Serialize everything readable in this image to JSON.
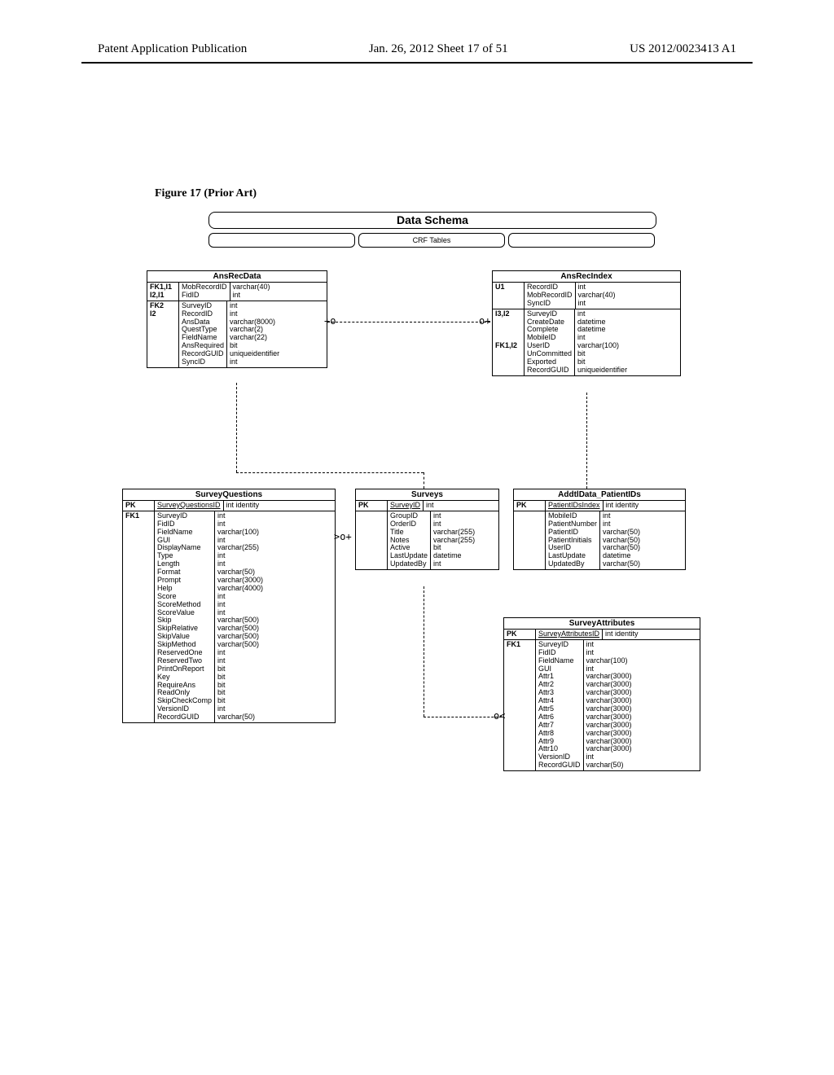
{
  "header": {
    "left": "Patent Application Publication",
    "center": "Jan. 26, 2012  Sheet 17 of 51",
    "right": "US 2012/0023413 A1"
  },
  "figure_caption": "Figure 17 (Prior Art)",
  "schema": {
    "title": "Data Schema",
    "subtitle_center": "CRF Tables",
    "tables": {
      "AnsRecData": {
        "sections": [
          {
            "key": "FK1,I1\nI2,I1",
            "rows": [
              [
                "MobRecordID",
                "varchar(40)"
              ],
              [
                "FidID",
                "int"
              ]
            ]
          },
          {
            "key": "FK2\nI2",
            "rows": [
              [
                "SurveyID",
                "int"
              ],
              [
                "RecordID",
                "int"
              ],
              [
                "AnsData",
                "varchar(8000)"
              ],
              [
                "QuestType",
                "varchar(2)"
              ],
              [
                "FieldName",
                "varchar(22)"
              ],
              [
                "AnsRequired",
                "bit"
              ],
              [
                "RecordGUID",
                "uniqueidentifier"
              ],
              [
                "SyncID",
                "int"
              ]
            ]
          }
        ]
      },
      "AnsRecIndex": {
        "sections": [
          {
            "key": "U1",
            "rows": [
              [
                "RecordID",
                "int"
              ],
              [
                "MobRecordID",
                "varchar(40)"
              ],
              [
                "SyncID",
                "int"
              ]
            ]
          },
          {
            "key": "I3,I2\n\n\n\nFK1,I2",
            "rows": [
              [
                "SurveyID",
                "int"
              ],
              [
                "CreateDate",
                "datetime"
              ],
              [
                "Complete",
                "datetime"
              ],
              [
                "MobileID",
                "int"
              ],
              [
                "UserID",
                "varchar(100)"
              ],
              [
                "UnCommitted",
                "bit"
              ],
              [
                "Exported",
                "bit"
              ],
              [
                "RecordGUID",
                "uniqueidentifier"
              ]
            ]
          }
        ]
      },
      "SurveyQuestions": {
        "sections": [
          {
            "key": "PK",
            "rows": [
              [
                "SurveyQuestionsID",
                "int identity"
              ]
            ],
            "underlineFirst": true
          },
          {
            "key": "FK1",
            "rows": [
              [
                "SurveyID",
                "int"
              ],
              [
                "FidID",
                "int"
              ],
              [
                "FieldName",
                "varchar(100)"
              ],
              [
                "GUI",
                "int"
              ],
              [
                "DisplayName",
                "varchar(255)"
              ],
              [
                "Type",
                "int"
              ],
              [
                "Length",
                "int"
              ],
              [
                "Format",
                "varchar(50)"
              ],
              [
                "Prompt",
                "varchar(3000)"
              ],
              [
                "Help",
                "varchar(4000)"
              ],
              [
                "Score",
                "int"
              ],
              [
                "ScoreMethod",
                "int"
              ],
              [
                "ScoreValue",
                "int"
              ],
              [
                "Skip",
                "varchar(500)"
              ],
              [
                "SkipRelative",
                "varchar(500)"
              ],
              [
                "SkipValue",
                "varchar(500)"
              ],
              [
                "SkipMethod",
                "varchar(500)"
              ],
              [
                "ReservedOne",
                "int"
              ],
              [
                "ReservedTwo",
                "int"
              ],
              [
                "PrintOnReport",
                "bit"
              ],
              [
                "Key",
                "bit"
              ],
              [
                "RequireAns",
                "bit"
              ],
              [
                "ReadOnly",
                "bit"
              ],
              [
                "SkipCheckComp",
                "bit"
              ],
              [
                "VersionID",
                "int"
              ],
              [
                "RecordGUID",
                "varchar(50)"
              ]
            ]
          }
        ]
      },
      "Surveys": {
        "sections": [
          {
            "key": "PK",
            "rows": [
              [
                "SurveyID",
                "int"
              ]
            ],
            "underlineFirst": true
          },
          {
            "key": "",
            "rows": [
              [
                "GroupID",
                "int"
              ],
              [
                "OrderID",
                "int"
              ],
              [
                "Title",
                "varchar(255)"
              ],
              [
                "Notes",
                "varchar(255)"
              ],
              [
                "Active",
                "bit"
              ],
              [
                "LastUpdate",
                "datetime"
              ],
              [
                "UpdatedBy",
                "int"
              ]
            ]
          }
        ]
      },
      "AddtlData_PatientIDs": {
        "sections": [
          {
            "key": "PK",
            "rows": [
              [
                "PatientIDsIndex",
                "int identity"
              ]
            ],
            "underlineFirst": true
          },
          {
            "key": "",
            "rows": [
              [
                "MobileID",
                "int"
              ],
              [
                "PatientNumber",
                "int"
              ],
              [
                "PatientID",
                "varchar(50)"
              ],
              [
                "PatientInitials",
                "varchar(50)"
              ],
              [
                "UserID",
                "varchar(50)"
              ],
              [
                "LastUpdate",
                "datetime"
              ],
              [
                "UpdatedBy",
                "varchar(50)"
              ]
            ]
          }
        ]
      },
      "SurveyAttributes": {
        "sections": [
          {
            "key": "PK",
            "rows": [
              [
                "SurveyAttributesID",
                "int identity"
              ]
            ],
            "underlineFirst": true
          },
          {
            "key": "FK1",
            "rows": [
              [
                "SurveyID",
                "int"
              ],
              [
                "FidID",
                "int"
              ],
              [
                "FieldName",
                "varchar(100)"
              ],
              [
                "GUI",
                "int"
              ],
              [
                "Attr1",
                "varchar(3000)"
              ],
              [
                "Attr2",
                "varchar(3000)"
              ],
              [
                "Attr3",
                "varchar(3000)"
              ],
              [
                "Attr4",
                "varchar(3000)"
              ],
              [
                "Attr5",
                "varchar(3000)"
              ],
              [
                "Attr6",
                "varchar(3000)"
              ],
              [
                "Attr7",
                "varchar(3000)"
              ],
              [
                "Attr8",
                "varchar(3000)"
              ],
              [
                "Attr9",
                "varchar(3000)"
              ],
              [
                "Attr10",
                "varchar(3000)"
              ],
              [
                "VersionID",
                "int"
              ],
              [
                "RecordGUID",
                "varchar(50)"
              ]
            ]
          }
        ]
      }
    }
  }
}
